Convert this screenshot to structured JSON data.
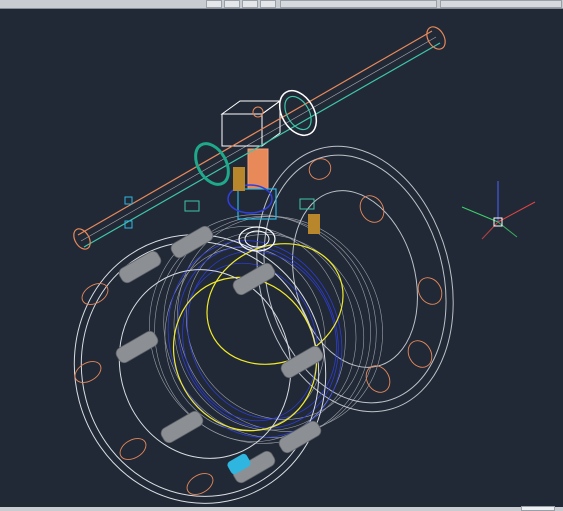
{
  "colors": {
    "background": "#212936",
    "wire_white": "#d9dde3",
    "wire_blue": "#2f3fe0",
    "wire_yellow": "#f2ea2a",
    "wire_orange": "#e8895a",
    "wire_teal": "#3fc6a8",
    "bolt_gray": "#8c8f94",
    "handle_teal": "#1fa88a",
    "ucs_x": "#e24545",
    "ucs_y": "#3fd06a",
    "ucs_z": "#4a63ff"
  },
  "icons": {
    "ucs": "ucs-axis-icon"
  }
}
